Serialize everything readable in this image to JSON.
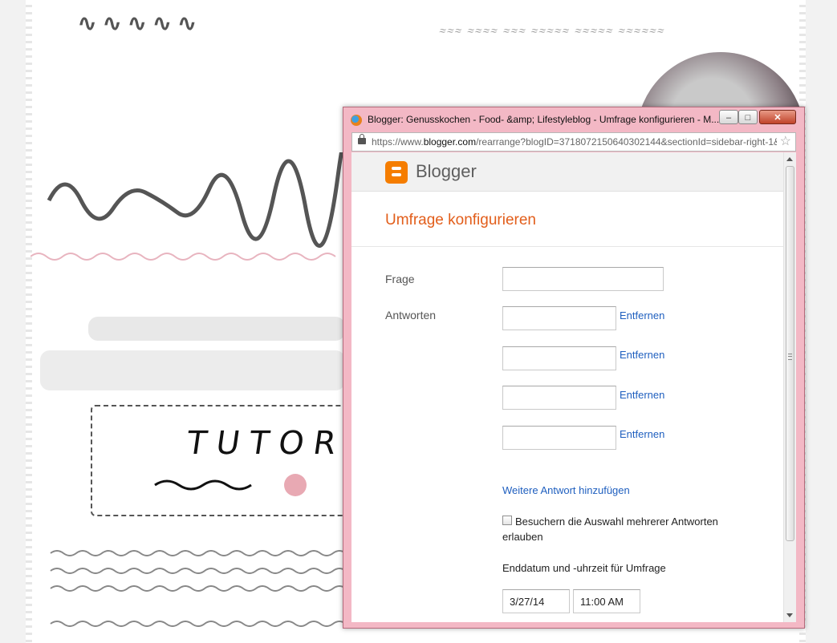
{
  "window": {
    "title": "Blogger: Genusskochen - Food- &amp; Lifestyleblog - Umfrage konfigurieren - M...",
    "minimize_label": "–",
    "maximize_label": "□",
    "close_label": "✕"
  },
  "address_bar": {
    "url_prefix": "https://www.",
    "url_domain": "blogger.com",
    "url_suffix": "/rearrange?blogID=3718072150640302144&sectionId=sidebar-right-1&"
  },
  "blogger": {
    "brand": "Blogger"
  },
  "form": {
    "title": "Umfrage konfigurieren",
    "question_label": "Frage",
    "question_value": "",
    "answers_label": "Antworten",
    "answers": [
      {
        "value": "",
        "remove_label": "Entfernen"
      },
      {
        "value": "",
        "remove_label": "Entfernen"
      },
      {
        "value": "",
        "remove_label": "Entfernen"
      },
      {
        "value": "",
        "remove_label": "Entfernen"
      }
    ],
    "add_answer_label": "Weitere Antwort hinzufügen",
    "multiple_answers_label": "Besuchern die Auswahl mehrerer Antworten erlauben",
    "multiple_answers_checked": false,
    "end_label": "Enddatum und -uhrzeit für Umfrage",
    "end_date": "3/27/14",
    "end_time": "11:00 AM"
  },
  "colors": {
    "accent": "#e25e1b",
    "link": "#1f5fbf",
    "blogger_orange": "#f57d00",
    "window_frame": "#f3b8c5"
  },
  "icons": {
    "browser": "firefox-icon",
    "lock": "lock-icon",
    "bookmark": "star-icon",
    "brand": "blogger-logo-icon"
  }
}
